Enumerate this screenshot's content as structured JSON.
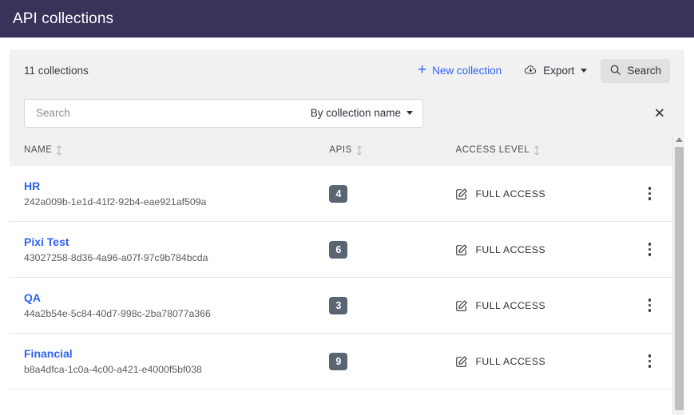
{
  "appbar": {
    "title": "API collections"
  },
  "toolbar": {
    "count_label": "11 collections",
    "new_collection_label": "New collection",
    "plus_icon": "plus-icon",
    "export_label": "Export",
    "export_icon": "cloud-download-icon",
    "search_label": "Search",
    "search_icon": "magnifier-icon"
  },
  "search": {
    "placeholder": "Search",
    "value": "",
    "scope_label": "By collection name",
    "close_icon": "close-icon"
  },
  "table": {
    "headers": [
      {
        "label": "NAME",
        "sort_icon": "sort-updown-icon"
      },
      {
        "label": "APIS",
        "sort_icon": "sort-updown-icon"
      },
      {
        "label": "ACCESS LEVEL",
        "sort_icon": "sort-updown-icon"
      }
    ],
    "rows": [
      {
        "name": "HR",
        "id": "242a009b-1e1d-41f2-92b4-eae921af509a",
        "apis": "4",
        "access_level": "FULL ACCESS",
        "access_icon": "edit-square-icon",
        "menu_icon": "kebab-menu-icon"
      },
      {
        "name": "Pixi Test",
        "id": "43027258-8d36-4a96-a07f-97c9b784bcda",
        "apis": "6",
        "access_level": "FULL ACCESS",
        "access_icon": "edit-square-icon",
        "menu_icon": "kebab-menu-icon"
      },
      {
        "name": "QA",
        "id": "44a2b54e-5c84-40d7-998c-2ba78077a366",
        "apis": "3",
        "access_level": "FULL ACCESS",
        "access_icon": "edit-square-icon",
        "menu_icon": "kebab-menu-icon"
      },
      {
        "name": "Financial",
        "id": "b8a4dfca-1c0a-4c00-a421-e4000f5bf038",
        "apis": "9",
        "access_level": "FULL ACCESS",
        "access_icon": "edit-square-icon",
        "menu_icon": "kebab-menu-icon"
      }
    ]
  },
  "colors": {
    "appbar_bg": "#3b3259",
    "accent_link": "#2f62f4",
    "card_bg": "#f1f1f1",
    "badge_bg": "#5a6472"
  }
}
